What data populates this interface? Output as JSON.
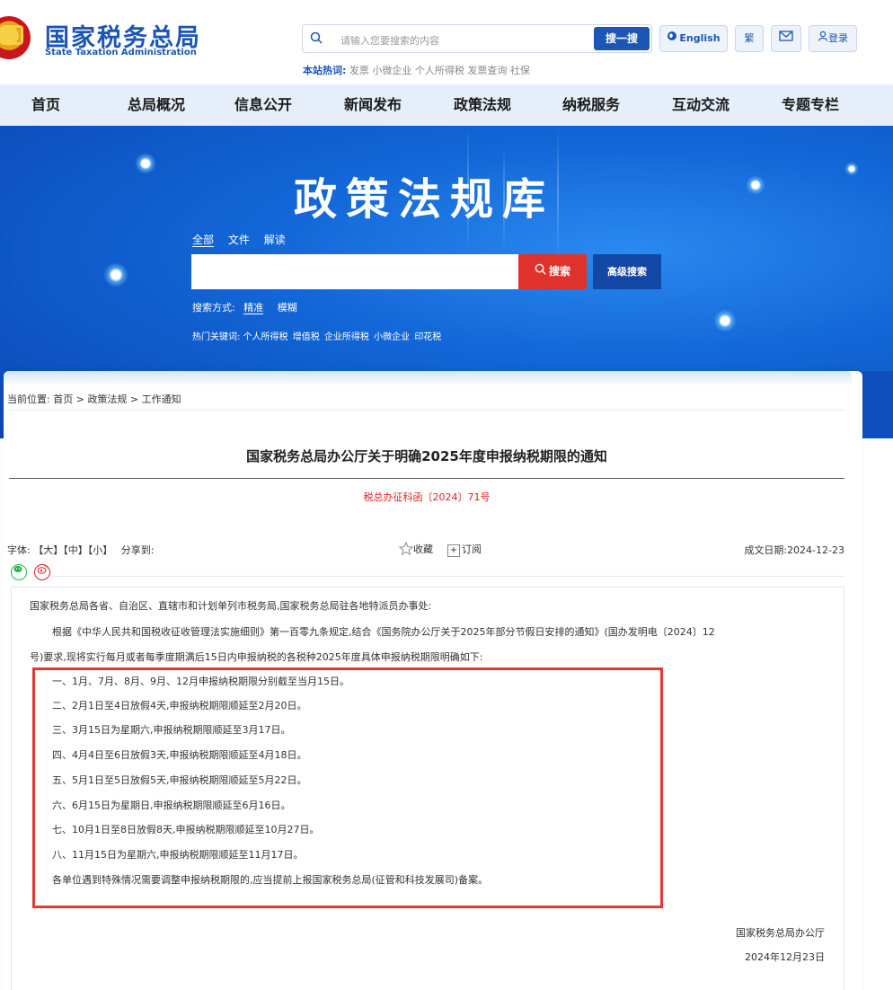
{
  "header": {
    "logo_cn": "国家税务总局",
    "logo_en": "State Taxation Administration",
    "search_placeholder": "请输入您要搜索的内容",
    "search_button": "搜一搜",
    "hot_label": "本站热词:",
    "hot_words": "发票 小微企业 个人所得税 发票查询 社保",
    "english_button": "English",
    "traditional_button": "繁",
    "login_button": "登录"
  },
  "nav": {
    "items": [
      "首页",
      "总局概况",
      "信息公开",
      "新闻发布",
      "政策法规",
      "纳税服务",
      "互动交流",
      "专题专栏"
    ]
  },
  "banner": {
    "title": "政策法规库",
    "tabs": [
      "全部",
      "文件",
      "解读"
    ],
    "search_button": "搜索",
    "advanced_button": "高级搜索",
    "mode_label": "搜索方式:",
    "mode_exact": "精准",
    "mode_fuzzy": "模糊",
    "hot_label": "热门关键词:",
    "hot_keywords": [
      "个人所得税",
      "增值税",
      "企业所得税",
      "小微企业",
      "印花税"
    ]
  },
  "breadcrumb": {
    "prefix": "当前位置:",
    "items": [
      "首页",
      "政策法规",
      "工作通知"
    ],
    "sep": " > "
  },
  "article": {
    "title": "国家税务总局办公厅关于明确2025年度申报纳税期限的通知",
    "doc_number": "税总办征科函〔2024〕71号",
    "font_label": "字体:",
    "font_large": "【大】",
    "font_medium": "【中】",
    "font_small": "【小】",
    "share_label": "分享到:",
    "favorite": "收藏",
    "subscribe": "订阅",
    "date_label": "成文日期:",
    "date_value": "2024-12-23",
    "salutation": "国家税务总局各省、自治区、直辖市和计划单列市税务局,国家税务总局驻各地特派员办事处:",
    "intro_line1": "根据《中华人民共和国税收征收管理法实施细则》第一百零九条规定,结合《国务院办公厅关于2025年部分节假日安排的通知》(国办发明电〔2024〕12",
    "intro_line2": "号)要求,现将实行每月或者每季度期满后15日内申报纳税的各税种2025年度具体申报纳税期限明确如下:",
    "items": [
      "一、1月、7月、8月、9月、12月申报纳税期限分别截至当月15日。",
      "二、2月1日至4日放假4天,申报纳税期限顺延至2月20日。",
      "三、3月15日为星期六,申报纳税期限顺延至3月17日。",
      "四、4月4日至6日放假3天,申报纳税期限顺延至4月18日。",
      "五、5月1日至5日放假5天,申报纳税期限顺延至5月22日。",
      "六、6月15日为星期日,申报纳税期限顺延至6月16日。",
      "七、10月1日至8日放假8天,申报纳税期限顺延至10月27日。",
      "八、11月15日为星期六,申报纳税期限顺延至11月17日。",
      "各单位遇到特殊情况需要调整申报纳税期限的,应当提前上报国家税务总局(征管和科技发展司)备案。"
    ],
    "signature_org": "国家税务总局办公厅",
    "signature_date": "2024年12月23日"
  },
  "colors": {
    "brand_blue": "#1b56b5",
    "nav_bg": "#e6eef9",
    "doc_number_red": "#e02020",
    "highlight_red": "#e53935",
    "search_red": "#e0322d"
  }
}
